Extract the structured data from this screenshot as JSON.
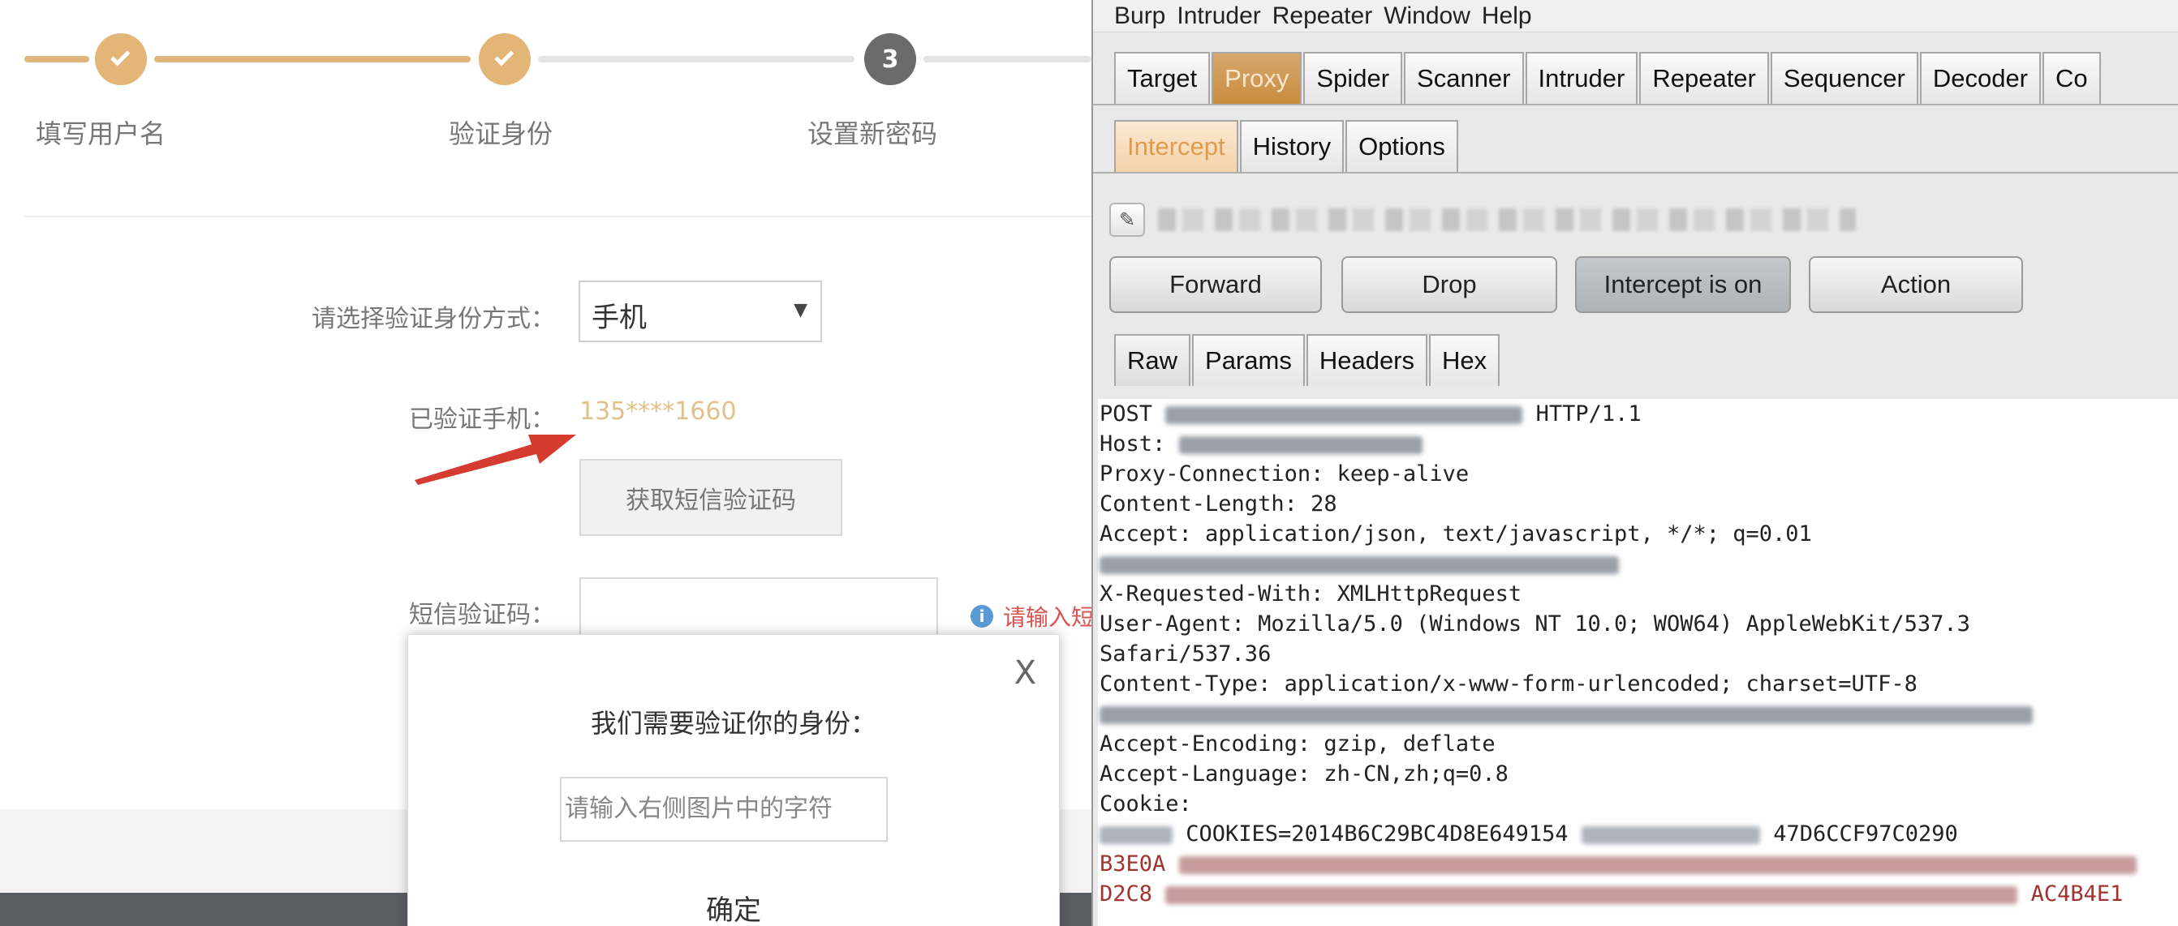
{
  "steps": [
    {
      "label": "填写用户名",
      "state": "done"
    },
    {
      "label": "验证身份",
      "state": "done"
    },
    {
      "label": "设置新密码",
      "state": "current",
      "number": "3"
    }
  ],
  "form": {
    "method_label": "请选择验证身份方式：",
    "method_value": "手机",
    "phone_label": "已验证手机：",
    "phone_value": "135****1660",
    "sms_button": "获取短信验证码",
    "sms_label": "短信验证码：",
    "sms_hint": "请输入短"
  },
  "modal": {
    "close": "X",
    "title": "我们需要验证你的身份：",
    "input_placeholder": "请输入右侧图片中的字符",
    "confirm": "确定"
  },
  "burp": {
    "menu": [
      "Burp",
      "Intruder",
      "Repeater",
      "Window",
      "Help"
    ],
    "main_tabs": [
      "Target",
      "Proxy",
      "Spider",
      "Scanner",
      "Intruder",
      "Repeater",
      "Sequencer",
      "Decoder",
      "Co"
    ],
    "active_main_tab": "Proxy",
    "sub_tabs": [
      "Intercept",
      "History",
      "Options"
    ],
    "active_sub_tab": "Intercept",
    "buttons": {
      "forward": "Forward",
      "drop": "Drop",
      "intercept": "Intercept is on",
      "action": "Action"
    },
    "view_tabs": [
      "Raw",
      "Params",
      "Headers",
      "Hex"
    ],
    "request": {
      "line1_method": "POST",
      "line1_proto": "HTTP/1.1",
      "host": "Host:",
      "proxy_conn": "Proxy-Connection: keep-alive",
      "content_length": "Content-Length: 28",
      "accept": "Accept: application/json, text/javascript, */*; q=0.01",
      "xrw": "X-Requested-With: XMLHttpRequest",
      "ua": "User-Agent: Mozilla/5.0 (Windows NT 10.0; WOW64) AppleWebKit/537.3",
      "safari": "Safari/537.36",
      "ctype": "Content-Type: application/x-www-form-urlencoded; charset=UTF-8",
      "encoding": "Accept-Encoding: gzip, deflate",
      "language": "Accept-Language: zh-CN,zh;q=0.8",
      "cookie": "Cookie:",
      "cookie_frag": "COOKIES=2014B6C29BC4D8E649154",
      "cookie_frag2": "47D6CCF97C0290",
      "b3": "B3E0A",
      "d2": "D2C8",
      "ac": "AC4B4E1"
    }
  }
}
